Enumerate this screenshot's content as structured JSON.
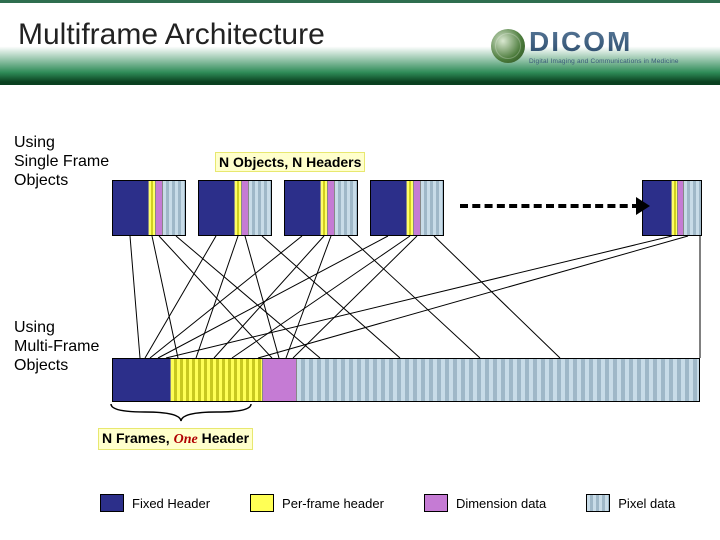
{
  "title": "Multiframe Architecture",
  "logo": {
    "brand": "DICOM",
    "tagline": "Digital Imaging and Communications in Medicine"
  },
  "labels": {
    "single": "Using\nSingle Frame\nObjects",
    "multi": "Using\nMulti-Frame\nObjects",
    "top_caption": "N Objects, N Headers",
    "bottom_caption_prefix": "N Frames, ",
    "bottom_caption_one": "One",
    "bottom_caption_suffix": " Header"
  },
  "legend": {
    "fixed_header": "Fixed Header",
    "per_frame_header": "Per-frame header",
    "dimension_data": "Dimension data",
    "pixel_data": "Pixel data"
  },
  "chart_data": {
    "type": "table",
    "title": "Multiframe Architecture",
    "rows": [
      {
        "approach": "Using Single Frame Objects",
        "objects": "N",
        "headers": "N",
        "summary": "N Objects, N Headers"
      },
      {
        "approach": "Using Multi-Frame Objects",
        "objects": "N frames",
        "headers": 1,
        "summary": "N Frames, One Header"
      }
    ],
    "object_segments": [
      "Fixed Header",
      "Per-frame header",
      "Dimension data",
      "Pixel data"
    ],
    "colors": {
      "Fixed Header": "#2c2f8a",
      "Per-frame header": "#ffff55",
      "Dimension data": "#c57bd4",
      "Pixel data": "#c8dce8"
    }
  }
}
